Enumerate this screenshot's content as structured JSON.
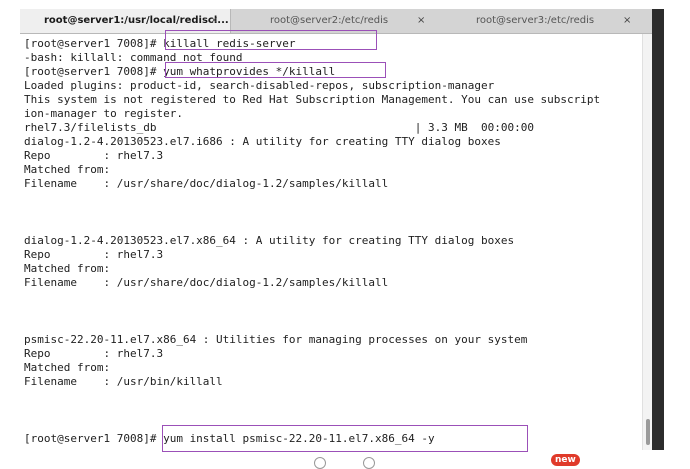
{
  "tabs": [
    {
      "label": "root@server1:/usr/local/rediscl...",
      "close": "×",
      "active": true
    },
    {
      "label": "root@server2:/etc/redis",
      "close": "×",
      "active": false
    },
    {
      "label": "root@server3:/etc/redis",
      "close": "×",
      "active": false
    }
  ],
  "terminal": {
    "lines": [
      "[root@server1 7008]# killall redis-server",
      "-bash: killall: command not found",
      "[root@server1 7008]# yum whatprovides */killall",
      "Loaded plugins: product-id, search-disabled-repos, subscription-manager",
      "This system is not registered to Red Hat Subscription Management. You can use subscript",
      "ion-manager to register.",
      "rhel7.3/filelists_db                                       | 3.3 MB  00:00:00",
      "dialog-1.2-4.20130523.el7.i686 : A utility for creating TTY dialog boxes",
      "Repo        : rhel7.3",
      "Matched from:",
      "Filename    : /usr/share/doc/dialog-1.2/samples/killall",
      "",
      "",
      "",
      "dialog-1.2-4.20130523.el7.x86_64 : A utility for creating TTY dialog boxes",
      "Repo        : rhel7.3",
      "Matched from:",
      "Filename    : /usr/share/doc/dialog-1.2/samples/killall",
      "",
      "",
      "",
      "psmisc-22.20-11.el7.x86_64 : Utilities for managing processes on your system",
      "Repo        : rhel7.3",
      "Matched from:",
      "Filename    : /usr/bin/killall",
      "",
      "",
      "",
      "[root@server1 7008]# yum install psmisc-22.20-11.el7.x86_64 -y"
    ]
  },
  "badge": "new",
  "colors": {
    "highlight": "#9b50b8",
    "badge": "#e03a2a",
    "terminal_bg": "#ffffff",
    "tabbar_bg": "#d4d4d4"
  }
}
